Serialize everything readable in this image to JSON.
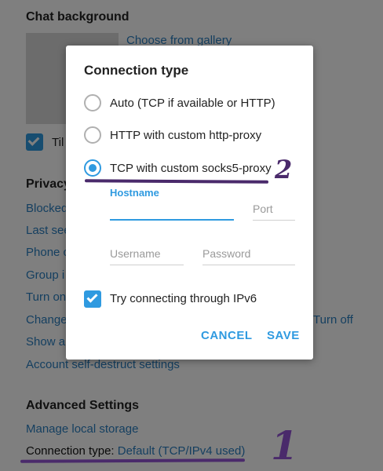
{
  "settings": {
    "chat_background": {
      "title": "Chat background",
      "choose_link": "Choose from gallery",
      "tile_label_partial": "Til"
    },
    "privacy": {
      "title": "Privacy",
      "links": [
        "Blocked",
        "Last see",
        "Phone c",
        "Group i",
        "Turn on",
        "Change",
        "Show al",
        "Account self-destruct settings"
      ],
      "turn_off_link": "Turn off"
    },
    "advanced": {
      "title": "Advanced Settings",
      "manage_storage": "Manage local storage",
      "connection_label": "Connection type:",
      "connection_value": "Default (TCP/IPv4 used)"
    }
  },
  "annotations": {
    "mark_1": "1",
    "mark_2": "2",
    "color": "#4a2a6b"
  },
  "dialog": {
    "title": "Connection type",
    "options": [
      {
        "label": "Auto (TCP if available or HTTP)",
        "selected": false
      },
      {
        "label": "HTTP with custom http-proxy",
        "selected": false
      },
      {
        "label": "TCP with custom socks5-proxy",
        "selected": true
      }
    ],
    "hostname_label": "Hostname",
    "hostname_value": "",
    "port_placeholder": "Port",
    "username_placeholder": "Username",
    "password_placeholder": "Password",
    "ipv6_label": "Try connecting through IPv6",
    "ipv6_checked": true,
    "cancel_label": "CANCEL",
    "save_label": "SAVE"
  },
  "colors": {
    "accent": "#2f9ae0",
    "link": "#2a7fc1",
    "overlay": "rgba(0,0,0,0.5)"
  }
}
